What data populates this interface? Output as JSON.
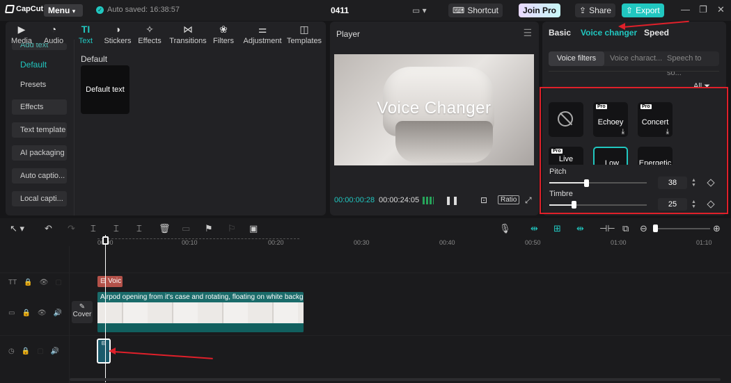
{
  "titlebar": {
    "app_name": "CapCut",
    "menu_label": "Menu",
    "autosave_text": "Auto saved: 16:38:57",
    "project_name": "0411",
    "shortcut_label": "Shortcut",
    "joinpro_label": "Join Pro",
    "share_label": "Share",
    "export_label": "Export"
  },
  "media_tabs": [
    {
      "label": "Media",
      "icon": "media-icon"
    },
    {
      "label": "Audio",
      "icon": "audio-icon"
    },
    {
      "label": "Text",
      "icon": "text-icon",
      "active": true
    },
    {
      "label": "Stickers",
      "icon": "stickers-icon"
    },
    {
      "label": "Effects",
      "icon": "effects-icon"
    },
    {
      "label": "Transitions",
      "icon": "transitions-icon"
    },
    {
      "label": "Filters",
      "icon": "filters-icon"
    },
    {
      "label": "Adjustment",
      "icon": "adjustment-icon"
    },
    {
      "label": "Templates",
      "icon": "templates-icon"
    }
  ],
  "sidebar": {
    "items": [
      {
        "label": "Add text"
      },
      {
        "label": "Default"
      },
      {
        "label": "Presets"
      },
      {
        "label": "Effects"
      },
      {
        "label": "Text template"
      },
      {
        "label": "AI packaging"
      },
      {
        "label": "Auto captio..."
      },
      {
        "label": "Local capti..."
      }
    ]
  },
  "text_panel": {
    "section_label": "Default",
    "card_label": "Default text"
  },
  "player": {
    "title": "Player",
    "overlay_text": "Voice Changer",
    "current_time": "00:00:00:28",
    "total_time": "00:00:24:05",
    "ratio_label": "Ratio"
  },
  "right_panel": {
    "tabs": [
      "Basic",
      "Voice changer",
      "Speed"
    ],
    "active_tab": "Voice changer",
    "subtabs": [
      "Voice filters",
      "Voice charact...",
      "Speech to so..."
    ],
    "filter_label": "All",
    "pro_badge": "Pro",
    "cards": [
      {
        "label": ""
      },
      {
        "label": "Echoey"
      },
      {
        "label": "Concert"
      },
      {
        "label": "Live"
      },
      {
        "label": "Low"
      },
      {
        "label": "Energetic"
      }
    ],
    "pitch": {
      "label": "Pitch",
      "value": "38",
      "fraction": 0.38
    },
    "timbre": {
      "label": "Timbre",
      "value": "25",
      "fraction": 0.25
    }
  },
  "timeline": {
    "ruler_labels": [
      "00:00",
      "00:10",
      "00:20",
      "00:30",
      "00:40",
      "00:50",
      "01:00",
      "01:10"
    ],
    "text_clip": "Voic",
    "video_clip_caption": "Airpod opening from it's case and rotating, floating on white backg",
    "cover_label": "Cover"
  },
  "colors": {
    "accent": "#21c7c0",
    "highlight": "#e0202a",
    "text_clip": "#b35149"
  }
}
